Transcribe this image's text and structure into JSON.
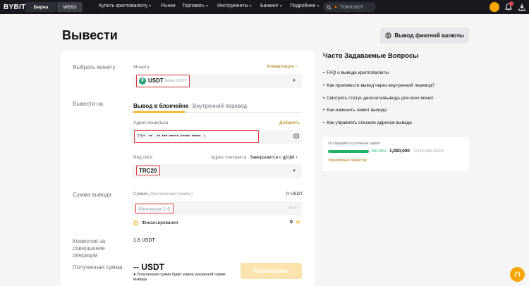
{
  "topbar": {
    "logo": "BYBIT",
    "segments": [
      "Биржа",
      "WEB3"
    ],
    "nav": [
      {
        "label": "Купить криптовалюту",
        "chevron": true
      },
      {
        "label": "Рынки",
        "chevron": false
      },
      {
        "label": "Торговать",
        "chevron": true
      },
      {
        "label": "Инструменты",
        "chevron": true
      },
      {
        "label": "Банкинг",
        "chevron": true
      },
      {
        "label": "Подробнее",
        "chevron": true
      }
    ],
    "search_text": "TON/USDT"
  },
  "page": {
    "title": "Вывести",
    "fiat_button": "Вывод фиатной валюты"
  },
  "form": {
    "coin_section_label": "Выбрать монету",
    "coin_field_label": "Монета",
    "convert_link": "Конвертация",
    "coin_symbol": "USDT",
    "coin_name": "Tether USDT",
    "withdraw_to_label": "Вывести на",
    "tabs": [
      "Вывод в блокчейне",
      "Внутренний перевод"
    ],
    "address_label": "Адрес кошелька",
    "add_link": "Добавить",
    "address_value": "TS•´.••’..••:•••:•••••·•••••:•••••.   I",
    "network_label": "Вид сети",
    "contract_prefix": "Адрес контракта",
    "contract_suffix": "Завершается с gjUjét",
    "network_value": "TRC20",
    "amount_section_label": "Сумма вывода",
    "amount_label": "Сумма",
    "amount_hint": "(Увеличение суммы)",
    "amount_available": "0 USDT",
    "amount_placeholder": "Минимум:2.6",
    "all_label": "Все",
    "funding_label": "Финансирования",
    "funding_value": "0",
    "fee_section_label": "Комиссия за совершение операции",
    "fee_value": "1.6 USDT",
    "received_section_label": "Полученная сумма",
    "received_value": "-- USDT",
    "received_note": "Полученная сумма будет равна указанной сумме вывода.",
    "confirm_button": "Подтвердить"
  },
  "faq": {
    "title": "Часто Задаваемые Вопросы",
    "items": [
      "FAQ о выводе криптовалюты",
      "Как произвести вывод через внутренний перевод?",
      "Смотреть статус депозита/вывода для всех монет",
      "Как изменить лимит вывода",
      "Как управлять списком адресов вывода"
    ]
  },
  "limit": {
    "label": "Оставшийся суточный лимит",
    "percent_text": "100.00%",
    "percent_value": 1.0,
    "remaining": "1,000,000",
    "total": "/1,000,000 USDT",
    "manage_link": "Управление лимитом"
  },
  "colors": {
    "accent": "#f7a600",
    "success": "#20b26c",
    "error_outline": "#e0353b",
    "tether": "#26a17b"
  }
}
